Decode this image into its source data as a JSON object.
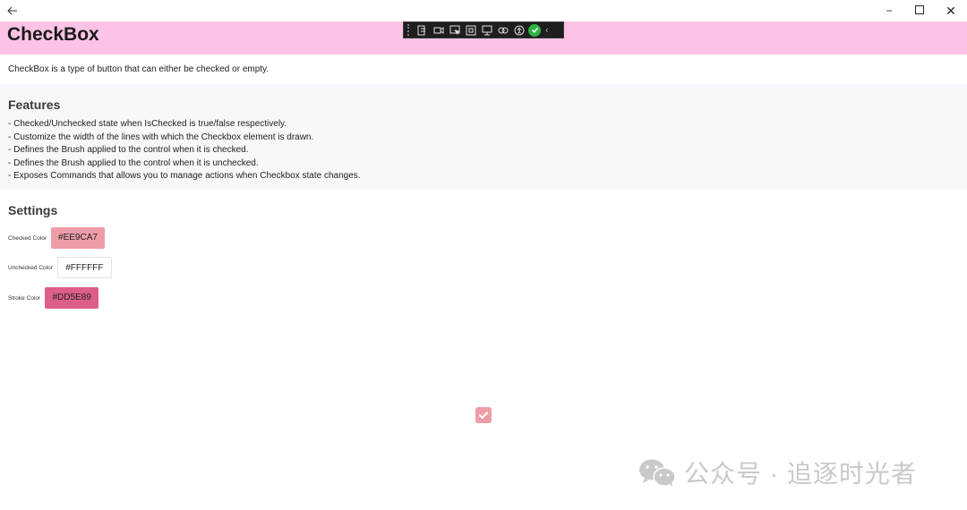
{
  "window": {
    "back_icon": "arrow-left-icon",
    "minimize_glyph": "−",
    "maximize_glyph": "☐",
    "close_glyph": "✕"
  },
  "header": {
    "title": "CheckBox",
    "background": "#fcc3e6"
  },
  "description": "CheckBox is a type of button that can either be checked or empty.",
  "features": {
    "title": "Features",
    "items": [
      "- Checked/Unchecked state when IsChecked is true/false respectively.",
      "- Customize the width of the lines with which the Checkbox element is drawn.",
      "- Defines the Brush applied to the control when it is checked.",
      "- Defines the Brush applied to the control when it is unchecked.",
      "- Exposes Commands that allows you to manage actions when Checkbox state changes."
    ]
  },
  "settings": {
    "title": "Settings",
    "checked": {
      "label": "Checked Color",
      "value": "#EE9CA7"
    },
    "unchecked": {
      "label": "Unchecked Color",
      "value": "#FFFFFF"
    },
    "stroke": {
      "label": "Stroke Color",
      "value": "#DD5E89"
    }
  },
  "demo_checkbox": {
    "checked": true,
    "color": "#EE9CA7"
  },
  "debug_toolbar": {
    "icons": [
      "live-visual-tree-icon",
      "record-icon",
      "select-element-icon",
      "display-layout-adorners-icon",
      "track-focus-icon",
      "binding-failures-icon",
      "accessibility-icon",
      "hot-reload-ok-icon",
      "collapse-icon"
    ]
  },
  "watermark": {
    "text": "公众号 · 追逐时光者",
    "icon": "wechat-icon"
  }
}
